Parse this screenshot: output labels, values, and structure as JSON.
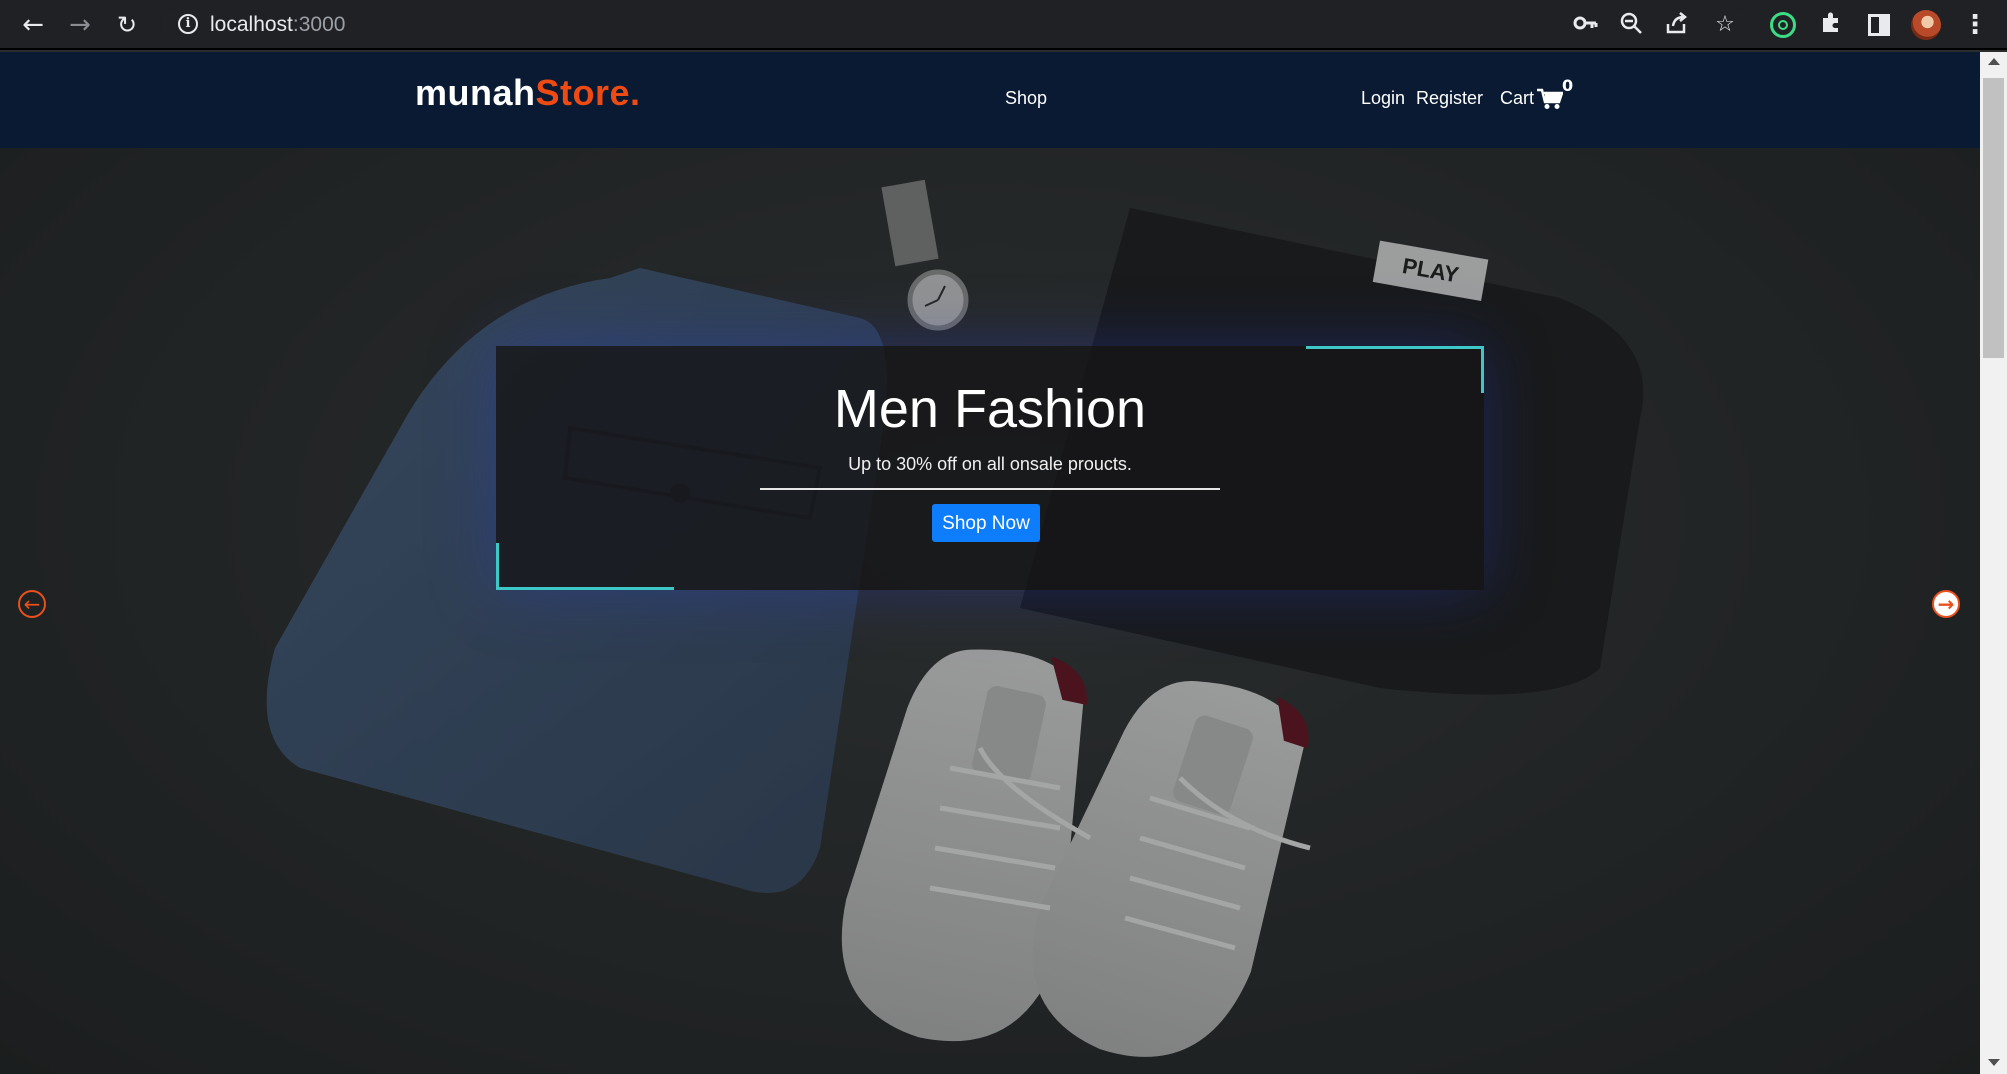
{
  "browser": {
    "url_host": "localhost",
    "url_port": ":3000",
    "icons": [
      "back-arrow-icon",
      "forward-arrow-icon",
      "reload-icon",
      "site-info-icon",
      "key-icon",
      "zoom-out-icon",
      "share-icon",
      "star-icon",
      "extension-ring-icon",
      "puzzle-icon",
      "side-panel-icon",
      "profile-avatar",
      "menu-kebab-icon"
    ]
  },
  "navbar": {
    "brand_main": "munah",
    "brand_accent": "Store.",
    "shop": "Shop",
    "login": "Login",
    "register": "Register",
    "cart": "Cart",
    "cart_count": "0"
  },
  "hero": {
    "title": "Men Fashion",
    "subtitle": "Up to 30% off on all onsale proucts.",
    "button": "Shop Now",
    "tag_text": "PLAY",
    "insole_text": "THIS IS AN INSOLE"
  },
  "colors": {
    "navbar_bg": "#0a1a33",
    "brand_accent": "#ee4a14",
    "button_blue": "#0d7dfb",
    "corner_teal": "#3ec7c7",
    "arrow_orange": "#e8501d"
  }
}
